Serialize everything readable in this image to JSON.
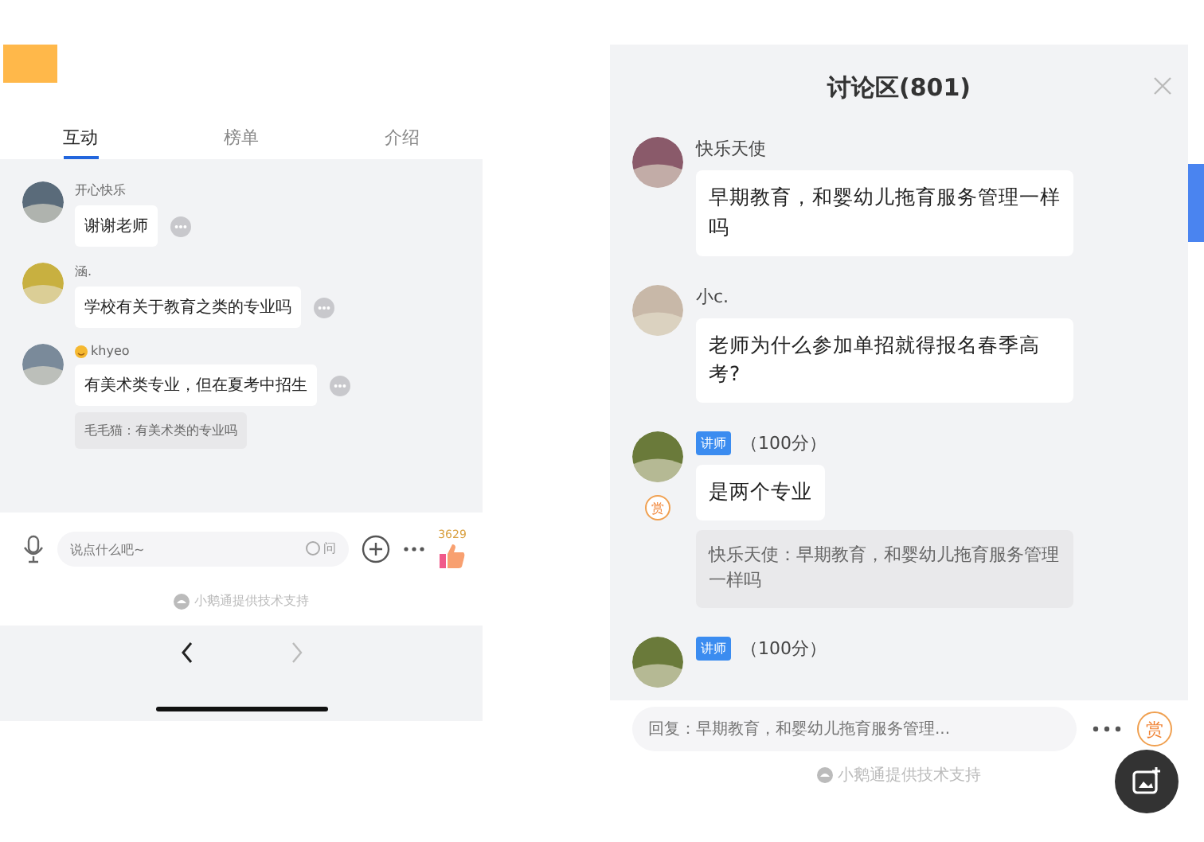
{
  "left": {
    "tabs": [
      {
        "label": "互动",
        "selected": true
      },
      {
        "label": "榜单",
        "selected": false
      },
      {
        "label": "介绍",
        "selected": false
      }
    ],
    "messages": [
      {
        "name": "开心快乐",
        "emoji": false,
        "text": "谢谢老师",
        "color": "#5a6b7a"
      },
      {
        "name": "涵.",
        "emoji": false,
        "text": "学校有关于教育之类的专业吗",
        "color": "#c8b040"
      },
      {
        "name": "khyeo",
        "emoji": true,
        "text": "有美术类专业，但在夏考中招生",
        "quote": "毛毛猫：有美术类的专业吗",
        "color": "#7a8a9a"
      }
    ],
    "input": {
      "placeholder": "说点什么吧~",
      "ask": "问"
    },
    "like_count": "3629",
    "footer": "小鹅通提供技术支持"
  },
  "right": {
    "title": "讨论区(801)",
    "messages": [
      {
        "kind": "user",
        "name": "快乐天使",
        "text": "早期教育，和婴幼儿拖育服务管理一样吗",
        "color": "#8a5a6a"
      },
      {
        "kind": "user",
        "name": "小c.",
        "text": "老师为什么参加单招就得报名春季高考?",
        "color": "#c8b8a8"
      },
      {
        "kind": "teacher",
        "badge": "讲师",
        "score": "（100分）",
        "text": "是两个专业",
        "quote": "快乐天使：早期教育，和婴幼儿拖育服务管理一样吗",
        "reward": "赏",
        "color": "#6a7a3a"
      },
      {
        "kind": "teacher",
        "badge": "讲师",
        "score": "（100分）",
        "color": "#6a7a3a"
      }
    ],
    "reply": {
      "placeholder": "回复：早期教育，和婴幼儿拖育服务管理..."
    },
    "reward": "赏",
    "footer": "小鹅通提供技术支持"
  }
}
